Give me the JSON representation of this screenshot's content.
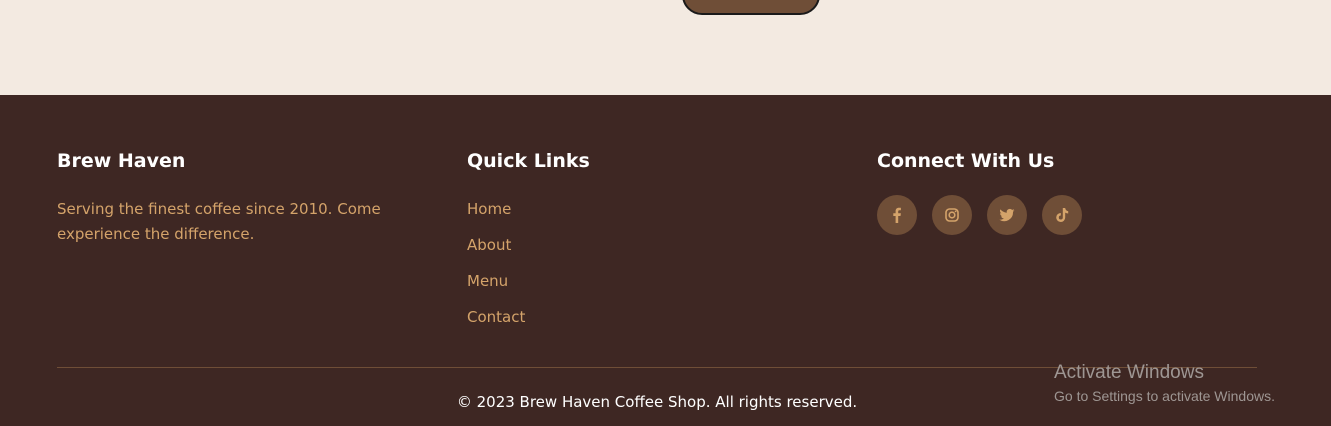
{
  "footer": {
    "brand": {
      "title": "Brew Haven",
      "description": "Serving the finest coffee since 2010. Come experience the difference."
    },
    "quick_links": {
      "title": "Quick Links",
      "items": [
        {
          "label": "Home"
        },
        {
          "label": "About"
        },
        {
          "label": "Menu"
        },
        {
          "label": "Contact"
        }
      ]
    },
    "connect": {
      "title": "Connect With Us",
      "icons": [
        "facebook-icon",
        "instagram-icon",
        "twitter-icon",
        "tiktok-icon"
      ]
    },
    "copyright": "© 2023 Brew Haven Coffee Shop. All rights reserved."
  },
  "watermark": {
    "title": "Activate Windows",
    "subtitle": "Go to Settings to activate Windows."
  },
  "colors": {
    "page_bg": "#f3eae1",
    "footer_bg": "#3e2723",
    "accent": "#d4a36a",
    "icon_bg": "#6f4e37"
  }
}
